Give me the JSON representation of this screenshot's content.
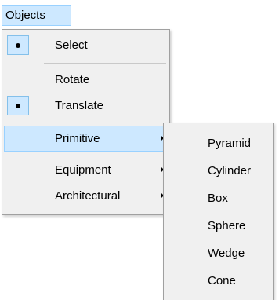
{
  "menubar": {
    "title": "Objects"
  },
  "menu": {
    "items": [
      {
        "label": "Select",
        "checked": true
      },
      {
        "label": "Rotate",
        "checked": false
      },
      {
        "label": "Translate",
        "checked": true
      },
      {
        "label": "Primitive",
        "submenu": true,
        "highlighted": true
      },
      {
        "label": "Equipment",
        "submenu": true
      },
      {
        "label": "Architectural",
        "submenu": true
      }
    ]
  },
  "submenu": {
    "items": [
      {
        "label": "Pyramid"
      },
      {
        "label": "Cylinder"
      },
      {
        "label": "Box"
      },
      {
        "label": "Sphere"
      },
      {
        "label": "Wedge"
      },
      {
        "label": "Cone"
      }
    ]
  },
  "colors": {
    "highlight_bg": "#cde8ff",
    "highlight_border": "#99d1ff",
    "menu_bg": "#f0f0f0",
    "menu_border": "#a0a0a0"
  }
}
